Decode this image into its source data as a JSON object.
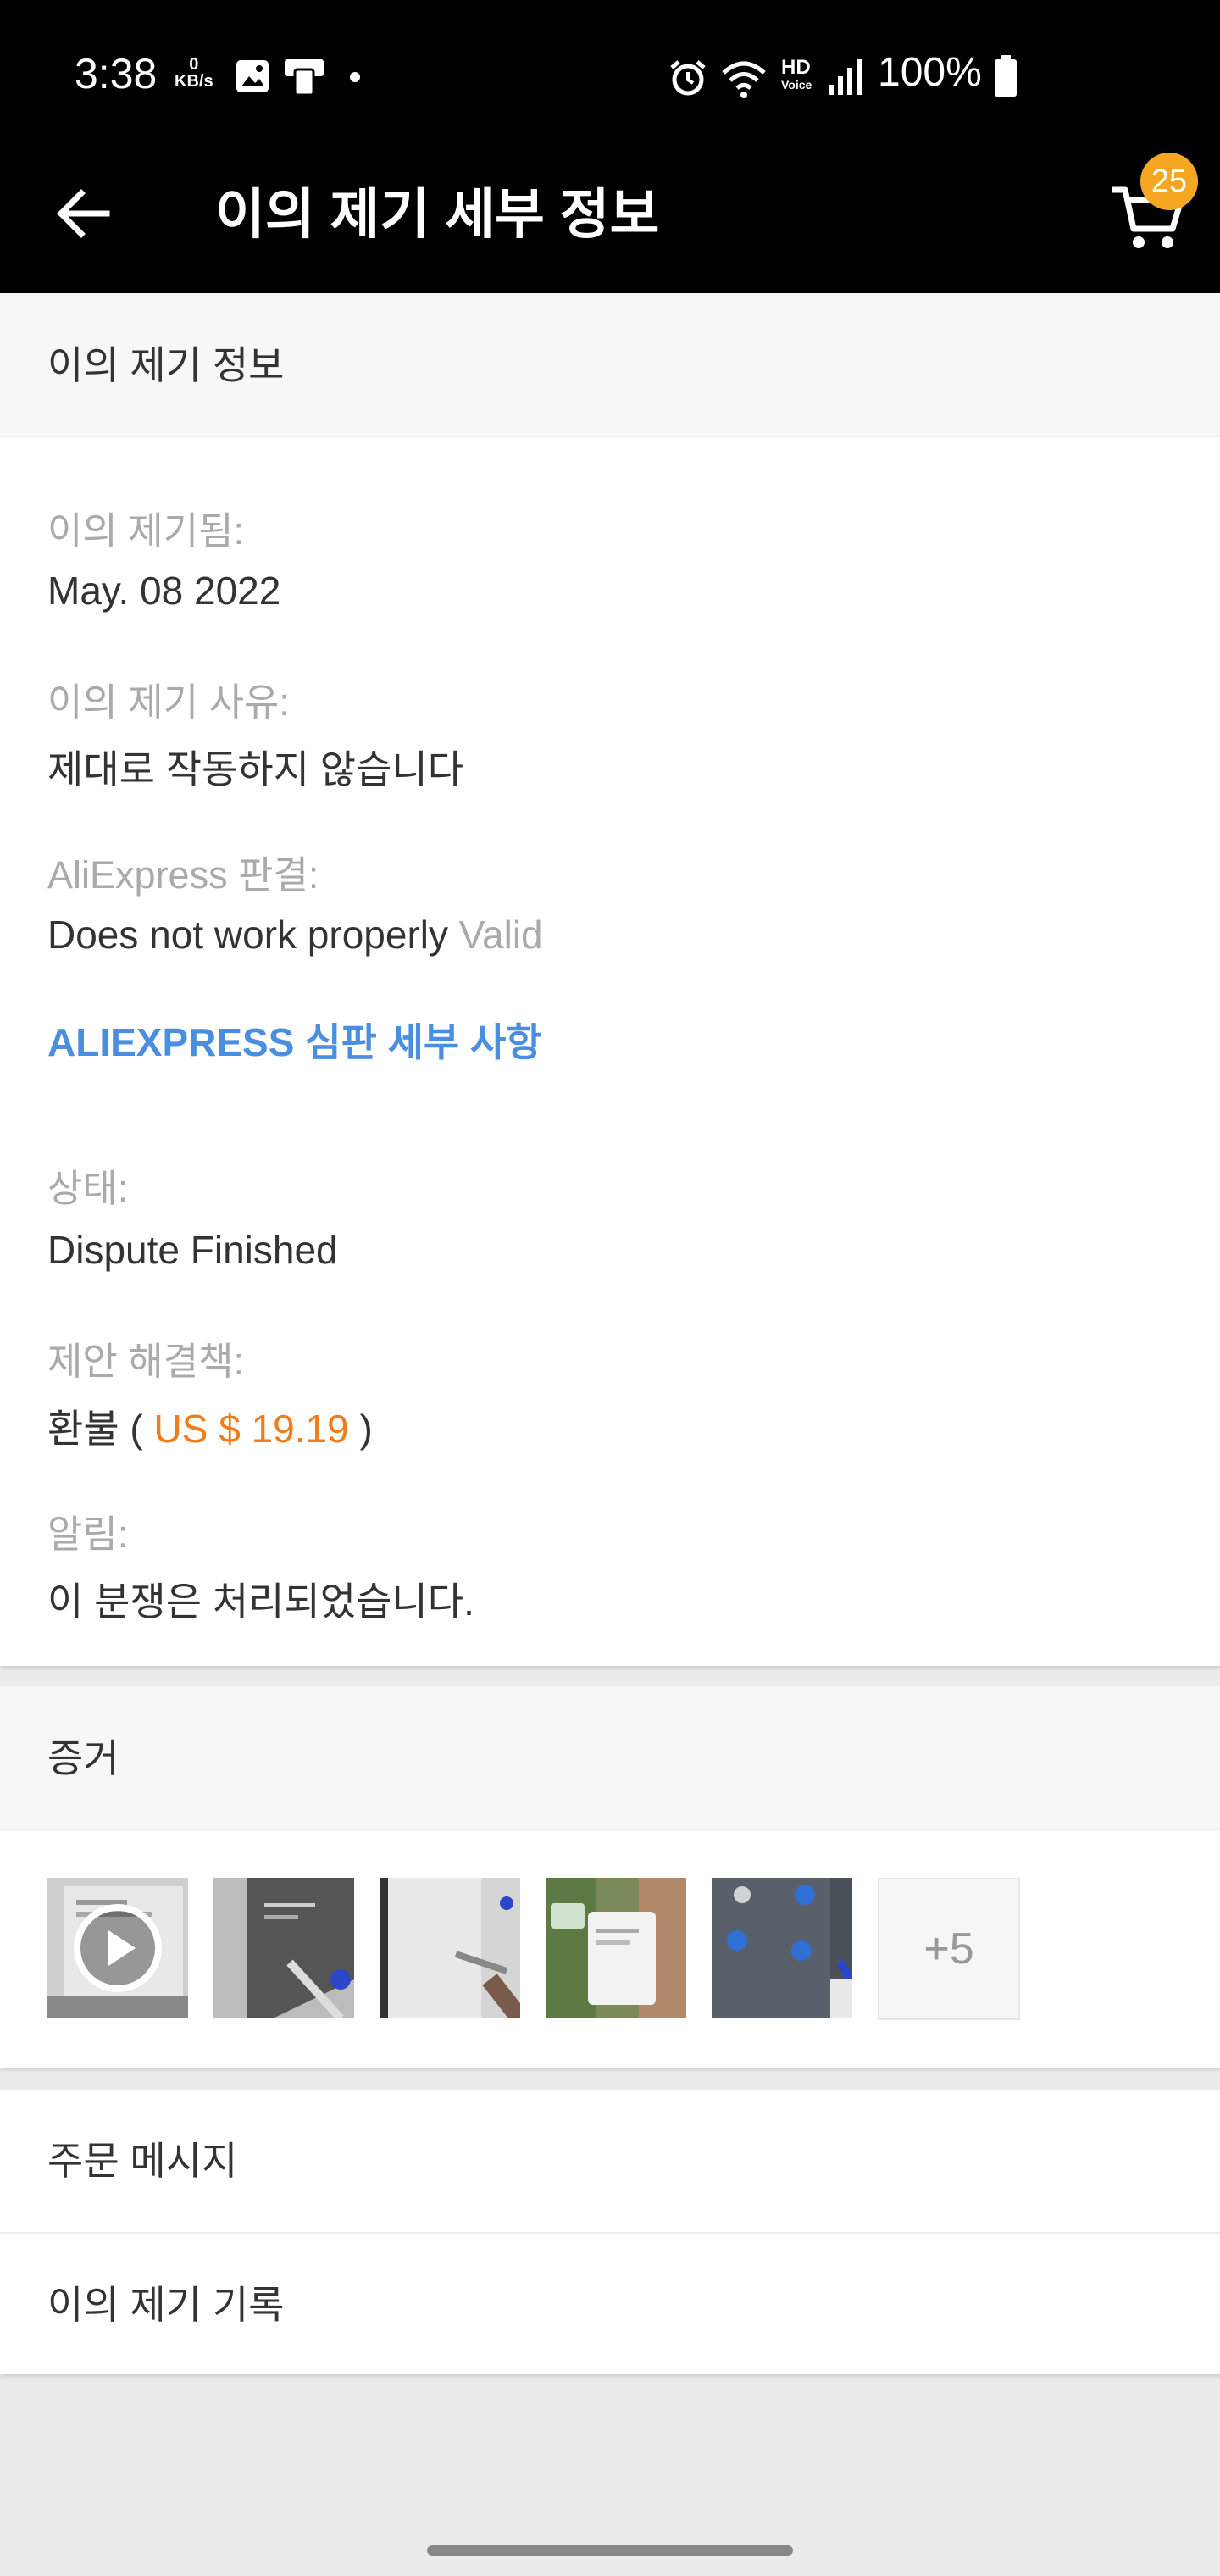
{
  "status_bar": {
    "time": "3:38",
    "net_speed_value": "0",
    "net_speed_unit": "KB/s",
    "battery": "100%",
    "icons": [
      "image-icon",
      "device-icon",
      "dot-icon",
      "alarm-icon",
      "wifi-icon",
      "hd-voice-icon",
      "signal-icon",
      "battery-icon"
    ],
    "hd_label": "HD",
    "voice_label": "Voice"
  },
  "header": {
    "title": "이의 제기 세부 정보",
    "cart_count": "25",
    "colors": {
      "bar": "#000000",
      "badge": "#f5a623"
    }
  },
  "dispute_info": {
    "section_title": "이의 제기 정보",
    "opened_label": "이의 제기됨:",
    "opened_value": "May. 08 2022",
    "reason_label": "이의 제기 사유:",
    "reason_value": "제대로 작동하지 않습니다",
    "verdict_label": "AliExpress 판결:",
    "verdict_value": "Does not work properly",
    "verdict_status": "Valid",
    "judgement_link": "ALIEXPRESS 심판 세부 사항",
    "status_label": "상태:",
    "status_value": "Dispute Finished",
    "solution_label": "제안 해결책:",
    "solution_prefix": "환불 (",
    "solution_amount": "US $ 19.19",
    "solution_suffix": ")",
    "notice_label": "알림:",
    "notice_value": "이 분쟁은 처리되었습니다.",
    "colors": {
      "link": "#4a8ee0",
      "price": "#f07c1c"
    }
  },
  "evidence": {
    "section_title": "증거",
    "thumbnails": [
      "video-thumbnail",
      "photo-tablet-pen",
      "photo-tablet-screen",
      "photo-app-screen",
      "photo-control-panel"
    ],
    "more_label": "+5"
  },
  "links": {
    "order_messages": "주문 메시지",
    "dispute_history": "이의 제기 기록"
  }
}
